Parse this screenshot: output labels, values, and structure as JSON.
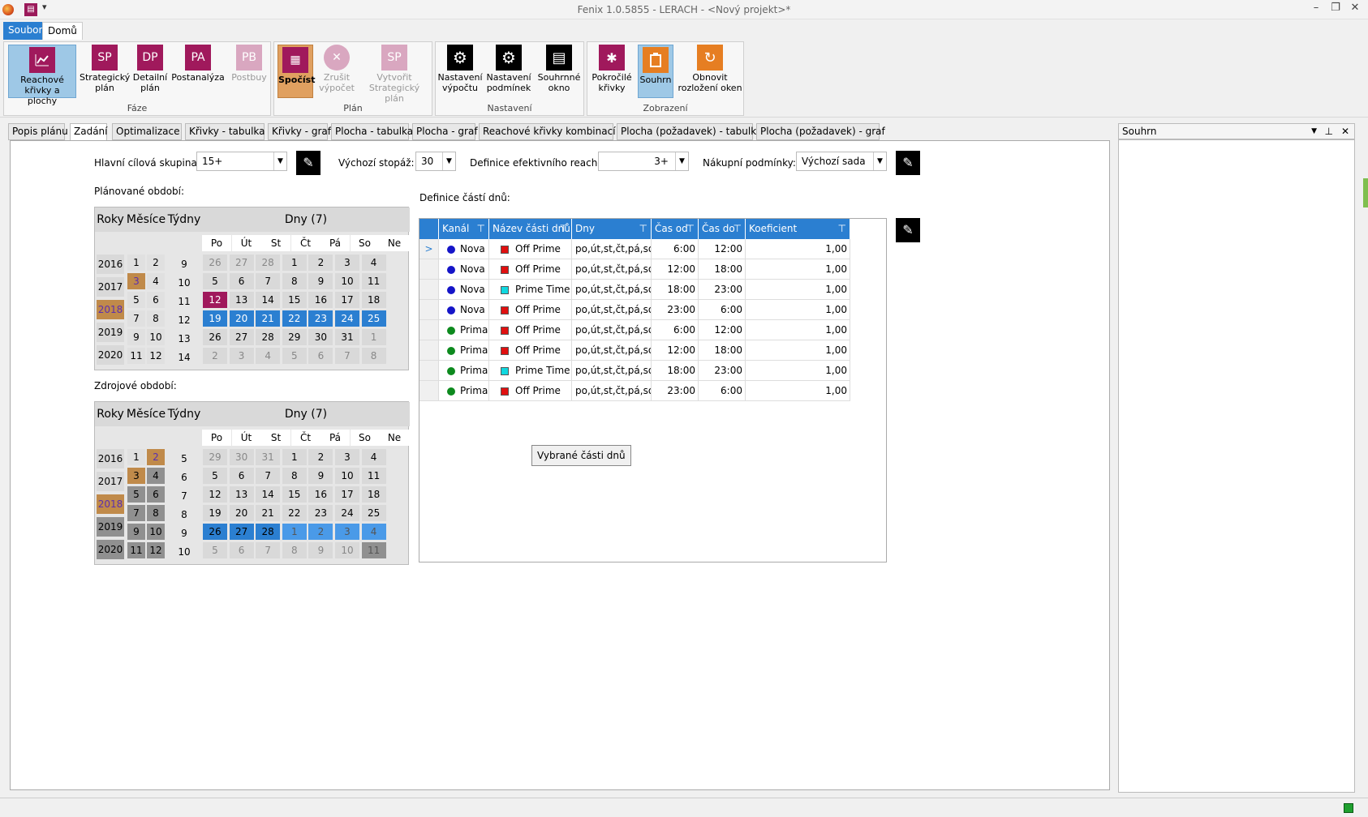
{
  "window": {
    "title": "Fenix 1.0.5855 - LERACH - <Nový projekt>*",
    "qat_icon": "app-menu-icon"
  },
  "menu": {
    "tabs": [
      "Soubor",
      "Domů"
    ]
  },
  "ribbon": {
    "faze": {
      "label": "Fáze",
      "buttons": [
        {
          "abbr": "",
          "label": "Reachové křivky a plochy",
          "color": "#a0195c",
          "selected": true
        },
        {
          "abbr": "SP",
          "label": "Strategický plán",
          "color": "#a0195c"
        },
        {
          "abbr": "DP",
          "label": "Detailní plán",
          "color": "#a0195c"
        },
        {
          "abbr": "PA",
          "label": "Postanalýza",
          "color": "#a0195c"
        },
        {
          "abbr": "PB",
          "label": "Postbuy",
          "color": "#d9a7c0",
          "disabled": true
        }
      ]
    },
    "plan": {
      "label": "Plán",
      "buttons": [
        {
          "abbr": "",
          "label": "Spočíst",
          "color": "#a0195c"
        },
        {
          "abbr": "✕",
          "label": "Zrušit výpočet",
          "color": "#d9a7c0",
          "disabled": true
        },
        {
          "abbr": "SP",
          "label": "Vytvořit Strategický plán",
          "color": "#d9a7c0",
          "disabled": true
        }
      ]
    },
    "nastaveni": {
      "label": "Nastavení",
      "buttons": [
        {
          "abbr": "⚙",
          "label": "Nastavení výpočtu",
          "color": "#000"
        },
        {
          "abbr": "⚙",
          "label": "Nastavení podmínek",
          "color": "#000"
        },
        {
          "abbr": "▤",
          "label": "Souhrnné okno",
          "color": "#000"
        }
      ]
    },
    "zobrazeni": {
      "label": "Zobrazení",
      "buttons": [
        {
          "abbr": "✱",
          "label": "Pokročilé křivky",
          "color": "#a0195c"
        },
        {
          "abbr": "",
          "label": "Souhrn",
          "color": "#e67e22",
          "selected": true
        },
        {
          "abbr": "↻",
          "label": "Obnovit rozložení oken",
          "color": "#e67e22"
        }
      ]
    }
  },
  "doc_tabs": [
    "Popis plánu",
    "Zadání",
    "Optimalizace",
    "Křivky - tabulka",
    "Křivky - graf",
    "Plocha - tabulka",
    "Plocha - graf",
    "Reachové křivky kombinací",
    "Plocha (požadavek) - tabulka",
    "Plocha (požadavek) - graf"
  ],
  "active_tab": "Zadání",
  "form": {
    "target_label": "Hlavní cílová skupina:",
    "target_value": "15+",
    "footage_label": "Výchozí stopáž:",
    "footage_value": "30",
    "reach_label": "Definice efektivního reache:",
    "reach_value": "3+",
    "purchase_label": "Nákupní podmínky:",
    "purchase_value": "Výchozí sada"
  },
  "planned": {
    "label": "Plánované období:",
    "headers": {
      "years": "Roky",
      "months": "Měsíce",
      "weeks": "Týdny",
      "days": "Dny (7)"
    },
    "weekdays": [
      "Po",
      "Út",
      "St",
      "Čt",
      "Pá",
      "So",
      "Ne"
    ],
    "years": [
      "2016",
      "2017",
      "2018",
      "2019",
      "2020"
    ],
    "months": [
      [
        "1",
        "2"
      ],
      [
        "3",
        "4"
      ],
      [
        "5",
        "6"
      ],
      [
        "7",
        "8"
      ],
      [
        "9",
        "10"
      ],
      [
        "11",
        "12"
      ]
    ],
    "weeks": [
      "9",
      "10",
      "11",
      "12",
      "13",
      "14"
    ],
    "days": [
      [
        "26",
        "27",
        "28",
        "1",
        "2",
        "3",
        "4"
      ],
      [
        "5",
        "6",
        "7",
        "8",
        "9",
        "10",
        "11"
      ],
      [
        "12",
        "13",
        "14",
        "15",
        "16",
        "17",
        "18"
      ],
      [
        "19",
        "20",
        "21",
        "22",
        "23",
        "24",
        "25"
      ],
      [
        "26",
        "27",
        "28",
        "29",
        "30",
        "31",
        "1"
      ],
      [
        "2",
        "3",
        "4",
        "5",
        "6",
        "7",
        "8"
      ]
    ]
  },
  "source": {
    "label": "Zdrojové období:",
    "weeks": [
      "5",
      "6",
      "7",
      "8",
      "9",
      "10"
    ],
    "days": [
      [
        "29",
        "30",
        "31",
        "1",
        "2",
        "3",
        "4"
      ],
      [
        "5",
        "6",
        "7",
        "8",
        "9",
        "10",
        "11"
      ],
      [
        "12",
        "13",
        "14",
        "15",
        "16",
        "17",
        "18"
      ],
      [
        "19",
        "20",
        "21",
        "22",
        "23",
        "24",
        "25"
      ],
      [
        "26",
        "27",
        "28",
        "1",
        "2",
        "3",
        "4"
      ],
      [
        "5",
        "6",
        "7",
        "8",
        "9",
        "10",
        "11"
      ]
    ]
  },
  "dayparts": {
    "label": "Definice částí dnů:",
    "columns": [
      "Kanál",
      "Název části dnů",
      "Dny",
      "Čas od",
      "Čas do",
      "Koeficient sezónnosti"
    ],
    "rows": [
      {
        "channel": "Nova",
        "ccolor": "#1515c8",
        "part": "Off Prime",
        "pcolor": "#e01010",
        "days": "po,út,st,čt,pá,so,ne",
        "from": "6:00",
        "to": "12:00",
        "coef": "1,00"
      },
      {
        "channel": "Nova",
        "ccolor": "#1515c8",
        "part": "Off Prime",
        "pcolor": "#e01010",
        "days": "po,út,st,čt,pá,so,ne",
        "from": "12:00",
        "to": "18:00",
        "coef": "1,00"
      },
      {
        "channel": "Nova",
        "ccolor": "#1515c8",
        "part": "Prime Time",
        "pcolor": "#10d8e0",
        "days": "po,út,st,čt,pá,so,ne",
        "from": "18:00",
        "to": "23:00",
        "coef": "1,00"
      },
      {
        "channel": "Nova",
        "ccolor": "#1515c8",
        "part": "Off Prime",
        "pcolor": "#e01010",
        "days": "po,út,st,čt,pá,so,ne",
        "from": "23:00",
        "to": "6:00",
        "coef": "1,00"
      },
      {
        "channel": "Prima",
        "ccolor": "#0d8a1e",
        "part": "Off Prime",
        "pcolor": "#e01010",
        "days": "po,út,st,čt,pá,so,ne",
        "from": "6:00",
        "to": "12:00",
        "coef": "1,00"
      },
      {
        "channel": "Prima",
        "ccolor": "#0d8a1e",
        "part": "Off Prime",
        "pcolor": "#e01010",
        "days": "po,út,st,čt,pá,so,ne",
        "from": "12:00",
        "to": "18:00",
        "coef": "1,00"
      },
      {
        "channel": "Prima",
        "ccolor": "#0d8a1e",
        "part": "Prime Time",
        "pcolor": "#10d8e0",
        "days": "po,út,st,čt,pá,so,ne",
        "from": "18:00",
        "to": "23:00",
        "coef": "1,00"
      },
      {
        "channel": "Prima",
        "ccolor": "#0d8a1e",
        "part": "Off Prime",
        "pcolor": "#e01010",
        "days": "po,út,st,čt,pá,so,ne",
        "from": "23:00",
        "to": "6:00",
        "coef": "1,00"
      }
    ],
    "selected_button": "Vybrané části dnů"
  },
  "summary_panel": {
    "title": "Souhrn"
  }
}
